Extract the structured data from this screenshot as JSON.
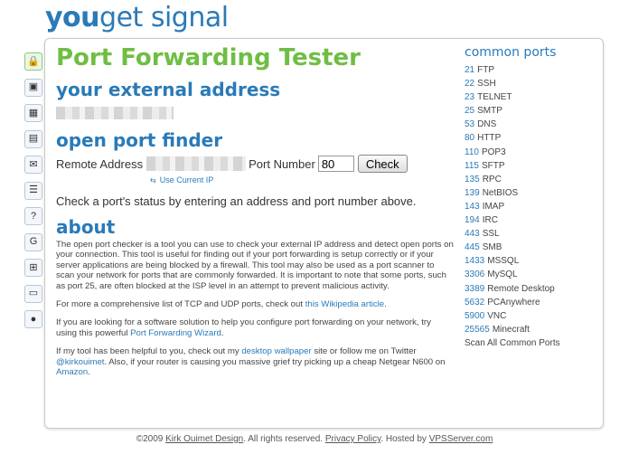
{
  "logo": {
    "you": "you",
    "rest": "get signal"
  },
  "side_tabs": [
    "lock-icon",
    "picture-icon",
    "image-icon",
    "calendar-icon",
    "mail-icon",
    "mail-list-icon",
    "help-icon",
    "google-icon",
    "windows-icon",
    "document-icon",
    "globe-icon"
  ],
  "title": "Port Forwarding Tester",
  "external": {
    "heading": "your external address"
  },
  "finder": {
    "heading": "open port finder",
    "remote_label": "Remote Address",
    "port_label": "Port Number",
    "port_value": "80",
    "check_label": "Check",
    "use_current_ip": "Use Current IP"
  },
  "blurb": "Check a port's status by entering an address and port number above.",
  "about": {
    "heading": "about",
    "p1": "The open port checker is a tool you can use to check your external IP address and detect open ports on your connection. This tool is useful for finding out if your port forwarding is setup correctly or if your server applications are being blocked by a firewall. This tool may also be used as a port scanner to scan your network for ports that are commonly forwarded. It is important to note that some ports, such as port 25, are often blocked at the ISP level in an attempt to prevent malicious activity.",
    "p2_pre": "For more a comprehensive list of TCP and UDP ports, check out ",
    "p2_link": "this Wikipedia article",
    "p2_post": ".",
    "p3_pre": "If you are looking for a software solution to help you configure port forwarding on your network, try using this powerful ",
    "p3_link": "Port Forwarding Wizard",
    "p3_post": ".",
    "p4_pre": "If my tool has been helpful to you, check out my ",
    "p4_link1": "desktop wallpaper",
    "p4_mid": " site or follow me on Twitter ",
    "p4_link2": "@kirkouimet",
    "p4_mid2": ". Also, if your router is causing you massive grief try picking up a cheap Netgear N600 on ",
    "p4_link3": "Amazon",
    "p4_post": "."
  },
  "common_ports": {
    "heading": "common ports",
    "items": [
      {
        "num": "21",
        "name": "FTP"
      },
      {
        "num": "22",
        "name": "SSH"
      },
      {
        "num": "23",
        "name": "TELNET"
      },
      {
        "num": "25",
        "name": "SMTP"
      },
      {
        "num": "53",
        "name": "DNS"
      },
      {
        "num": "80",
        "name": "HTTP"
      },
      {
        "num": "110",
        "name": "POP3"
      },
      {
        "num": "115",
        "name": "SFTP"
      },
      {
        "num": "135",
        "name": "RPC"
      },
      {
        "num": "139",
        "name": "NetBIOS"
      },
      {
        "num": "143",
        "name": "IMAP"
      },
      {
        "num": "194",
        "name": "IRC"
      },
      {
        "num": "443",
        "name": "SSL"
      },
      {
        "num": "445",
        "name": "SMB"
      },
      {
        "num": "1433",
        "name": "MSSQL"
      },
      {
        "num": "3306",
        "name": "MySQL"
      },
      {
        "num": "3389",
        "name": "Remote Desktop"
      },
      {
        "num": "5632",
        "name": "PCAnywhere"
      },
      {
        "num": "5900",
        "name": "VNC"
      },
      {
        "num": "25565",
        "name": "Minecraft"
      }
    ],
    "scan_all": "Scan All Common Ports"
  },
  "footer": {
    "copyright": "©2009 ",
    "author": "Kirk Ouimet Design",
    "rights": ". All rights reserved. ",
    "privacy": "Privacy Policy",
    "hosted": ". Hosted by ",
    "host": "VPSServer.com"
  }
}
